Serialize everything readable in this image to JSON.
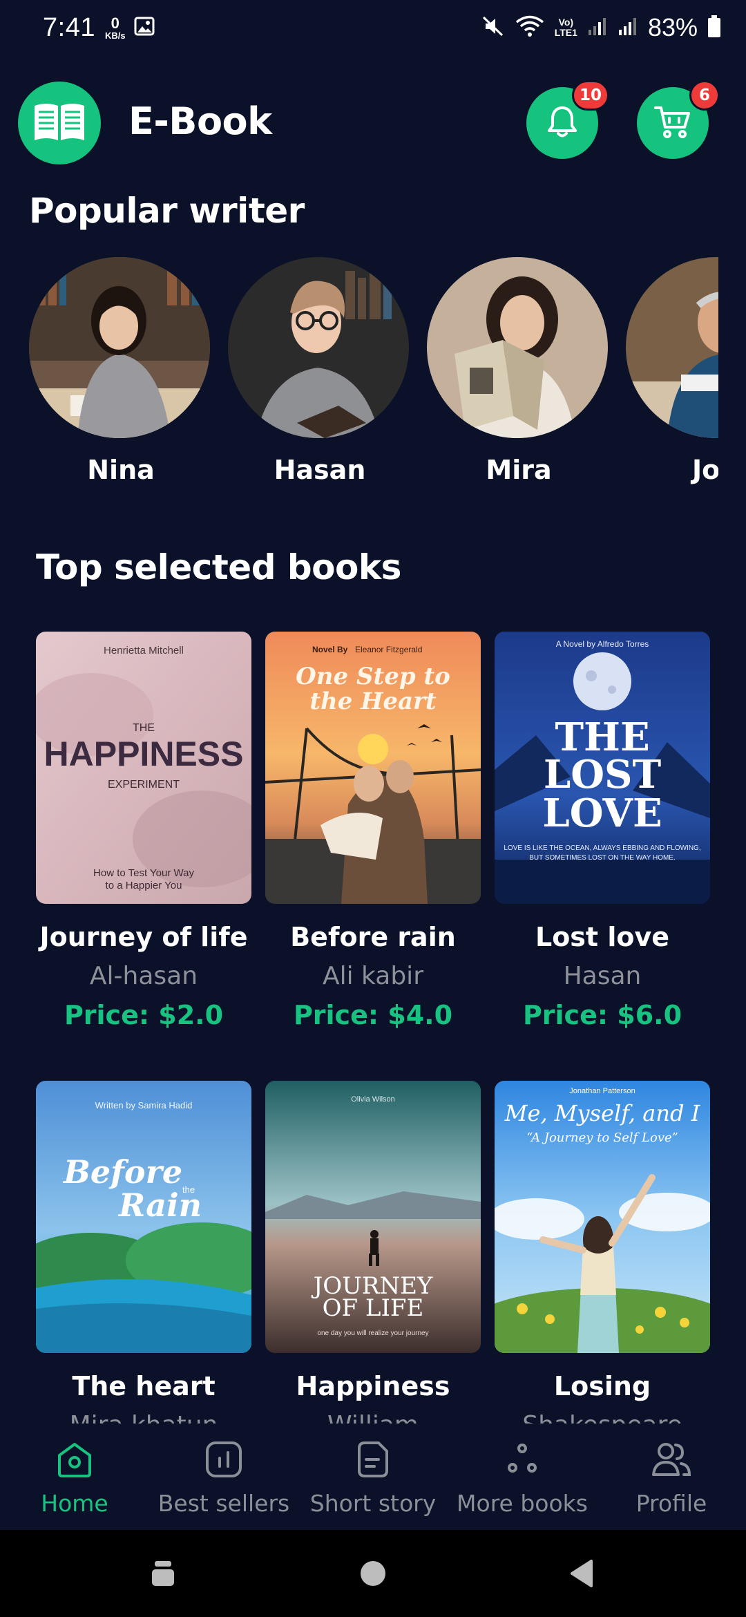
{
  "status_bar": {
    "time": "7:41",
    "net_speed_value": "0",
    "net_speed_unit": "KB/s",
    "lte_line1": "Vo)",
    "lte_line2": "LTE1",
    "battery_percent": "83%"
  },
  "header": {
    "app_title": "E-Book",
    "logo_icon": "open-book-icon",
    "notifications_badge": "10",
    "cart_badge": "6"
  },
  "writers": {
    "section_title": "Popular writer",
    "items": [
      {
        "name": "Nina"
      },
      {
        "name": "Hasan"
      },
      {
        "name": "Mira"
      },
      {
        "name": "Jo"
      }
    ]
  },
  "books": {
    "section_title": "Top selected books",
    "items": [
      {
        "title": "Journey of life",
        "author": "Al-hasan",
        "price": "Price: $2.0",
        "cover_lines": [
          "Henrietta Mitchell",
          "THE",
          "HAPPINESS",
          "EXPERIMENT",
          "How to Test Your Way",
          "to a Happier You"
        ]
      },
      {
        "title": "Before rain",
        "author": "Ali kabir",
        "price": "Price: $4.0",
        "cover_lines": [
          "Novel By",
          "Eleanor Fitzgerald",
          "One Step to",
          "the Heart"
        ]
      },
      {
        "title": "Lost love",
        "author": "Hasan",
        "price": "Price: $6.0",
        "cover_lines": [
          "A Novel by Alfredo Torres",
          "THE",
          "LOST",
          "LOVE",
          "LOVE IS LIKE THE OCEAN, ALWAYS EBBING AND FLOWING,",
          "BUT SOMETIMES LOST ON THE WAY HOME."
        ]
      },
      {
        "title": "The heart",
        "author": "Mira khatun",
        "price": "",
        "cover_lines": [
          "Written by Samira Hadid",
          "Before",
          "the",
          "Rain"
        ]
      },
      {
        "title": "Happiness",
        "author": "William",
        "price": "",
        "cover_lines": [
          "Olivia Wilson",
          "JOURNEY",
          "OF LIFE",
          "one day you will realize your journey"
        ]
      },
      {
        "title": "Losing",
        "author": "Shakespeare",
        "price": "",
        "cover_lines": [
          "Jonathan Patterson",
          "Me, Myself, and I",
          "“A Journey to Self Love”"
        ]
      }
    ]
  },
  "bottom_nav": {
    "items": [
      {
        "label": "Home",
        "icon": "home-icon",
        "active": true
      },
      {
        "label": "Best sellers",
        "icon": "bar-chart-icon",
        "active": false
      },
      {
        "label": "Short story",
        "icon": "document-icon",
        "active": false
      },
      {
        "label": "More books",
        "icon": "dots-icon",
        "active": false
      },
      {
        "label": "Profile",
        "icon": "users-icon",
        "active": false
      }
    ]
  },
  "colors": {
    "background": "#0a1128",
    "accent": "#15c27e",
    "price": "#18c382",
    "badge": "#ef3a3a",
    "muted": "#8e9199"
  }
}
